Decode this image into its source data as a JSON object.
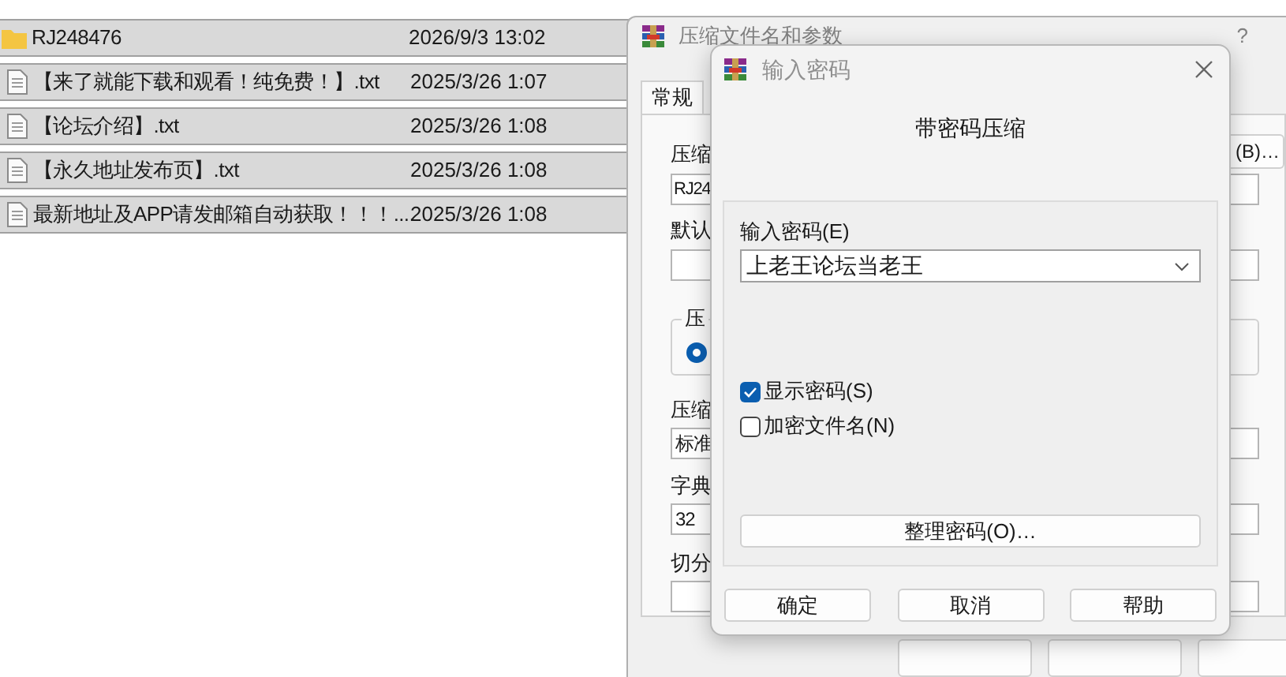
{
  "file_list": {
    "rows": [
      {
        "kind": "folder",
        "name": "RJ248476",
        "modified": "2026/9/3 13:02",
        "selected": true
      },
      {
        "kind": "text",
        "name": "【来了就能下载和观看！纯免费！】.txt",
        "modified": "2025/3/26 1:07",
        "selected": true
      },
      {
        "kind": "text",
        "name": "【论坛介绍】.txt",
        "modified": "2025/3/26 1:08",
        "selected": true
      },
      {
        "kind": "text",
        "name": "【永久地址发布页】.txt",
        "modified": "2025/3/26 1:08",
        "selected": true
      },
      {
        "kind": "text",
        "name": "最新地址及APP请发邮箱自动获取！！！....",
        "modified": "2025/3/26 1:08",
        "selected": true
      }
    ]
  },
  "archive_dialog": {
    "title": "压缩文件名和参数",
    "help": "?",
    "tabs": [
      {
        "label": "常规",
        "selected": true
      }
    ],
    "archive_name_label": "压缩",
    "browse_button": "(B)…",
    "archive_name": "RJ24",
    "profile_label": "默认",
    "format_group_label": "压",
    "format_options": [
      {
        "selected": true
      }
    ],
    "method_label": "压缩",
    "method": "标准",
    "dictionary_label": "字典",
    "dictionary": "32",
    "split_label": "切分"
  },
  "password_dialog": {
    "title": "输入密码",
    "heading": "带密码压缩",
    "password_label": "输入密码(E)",
    "password": "上老王论坛当老王",
    "options": [
      {
        "label": "显示密码(S)",
        "checked": true
      },
      {
        "label": "加密文件名(N)",
        "checked": false
      }
    ],
    "organize_button": "整理密码(O)…",
    "buttons": [
      "确定",
      "取消",
      "帮助"
    ]
  }
}
